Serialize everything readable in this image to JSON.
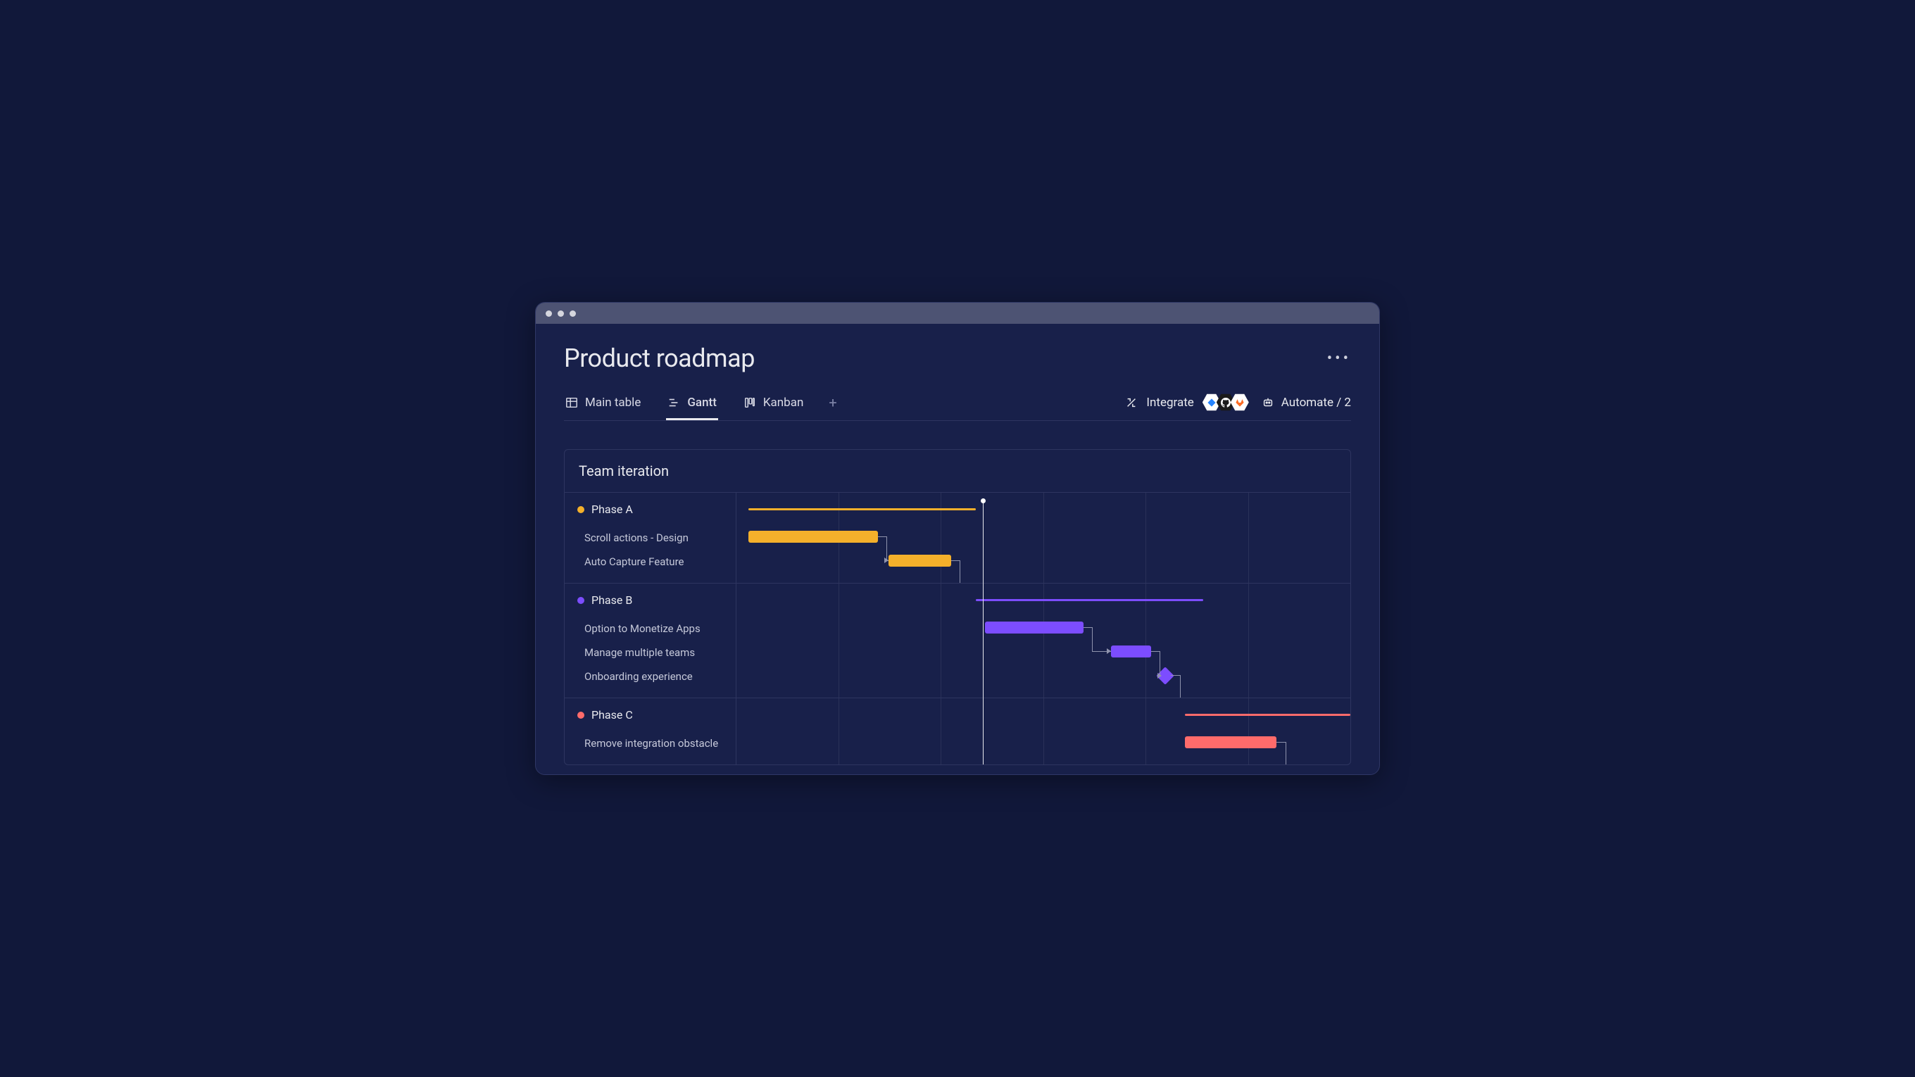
{
  "page": {
    "title": "Product roadmap"
  },
  "tabs": {
    "main_table": "Main table",
    "gantt": "Gantt",
    "kanban": "Kanban"
  },
  "toolbar": {
    "integrate": "Integrate",
    "automate": "Automate / 2"
  },
  "board": {
    "title": "Team iteration",
    "grid_columns": 6,
    "marker_pct": 40.1,
    "phases": [
      {
        "name": "Phase A",
        "color": "#f4b02b",
        "line_start_pct": 2,
        "line_end_pct": 39,
        "tasks": [
          {
            "name": "Scroll actions - Design",
            "type": "bar",
            "start_pct": 2,
            "end_pct": 23
          },
          {
            "name": "Auto Capture Feature",
            "type": "bar",
            "start_pct": 24.8,
            "end_pct": 35
          }
        ]
      },
      {
        "name": "Phase B",
        "color": "#7c4dff",
        "line_start_pct": 39,
        "line_end_pct": 76,
        "tasks": [
          {
            "name": "Option to Monetize Apps",
            "type": "bar",
            "start_pct": 40.5,
            "end_pct": 56.5
          },
          {
            "name": "Manage multiple teams",
            "type": "bar",
            "start_pct": 61,
            "end_pct": 67.5
          },
          {
            "name": "Onboarding experience",
            "type": "diamond",
            "pos_pct": 69.8
          }
        ]
      },
      {
        "name": "Phase C",
        "color": "#ff6b6b",
        "line_start_pct": 73,
        "line_end_pct": 100,
        "tasks": [
          {
            "name": "Remove integration obstacle",
            "type": "bar",
            "start_pct": 73,
            "end_pct": 88
          }
        ]
      }
    ]
  }
}
